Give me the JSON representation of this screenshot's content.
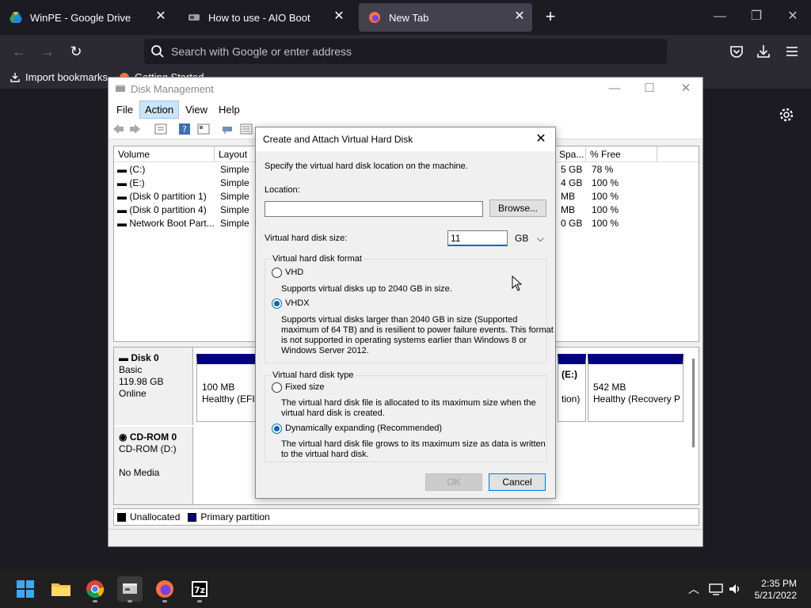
{
  "browser": {
    "tabs": [
      {
        "label": "WinPE - Google Drive",
        "active": false
      },
      {
        "label": "How to use - AIO Boot",
        "active": false
      },
      {
        "label": "New Tab",
        "active": true
      }
    ],
    "new_tab_glyph": "+",
    "controls": {
      "minimize": "—",
      "restore": "❐",
      "close": "✕"
    },
    "url_placeholder": "Search with Google or enter address",
    "bookmarks": {
      "import": "Import bookmarks...",
      "getting_started": "Getting Started"
    }
  },
  "disk_management": {
    "title": "Disk Management",
    "menu": [
      "File",
      "Action",
      "View",
      "Help"
    ],
    "selected_menu": "Action",
    "columns": {
      "volume": "Volume",
      "layout": "Layout",
      "free_space": "Spa...",
      "pct_free": "% Free"
    },
    "volumes": [
      {
        "name": "(C:)",
        "layout": "Simple",
        "free": "5 GB",
        "pct": "78 %"
      },
      {
        "name": "(E:)",
        "layout": "Simple",
        "free": "4 GB",
        "pct": "100 %"
      },
      {
        "name": "(Disk 0 partition 1)",
        "layout": "Simple",
        "free": "MB",
        "pct": "100 %"
      },
      {
        "name": "(Disk 0 partition 4)",
        "layout": "Simple",
        "free": "MB",
        "pct": "100 %"
      },
      {
        "name": "Network Boot Part...",
        "layout": "Simple",
        "free": "0 GB",
        "pct": "100 %"
      }
    ],
    "disk0": {
      "name": "Disk 0",
      "type": "Basic",
      "size": "119.98 GB",
      "status": "Online"
    },
    "disk0_partitions": {
      "p1_size": "100 MB",
      "p1_status": "Healthy (EFI S",
      "e_label": "(E:)",
      "e_status": "tion)",
      "recovery_size": "542 MB",
      "recovery_status": "Healthy (Recovery P"
    },
    "cdrom": {
      "name": "CD-ROM 0",
      "drive": "CD-ROM (D:)",
      "media": "No Media"
    },
    "legend": {
      "unallocated": "Unallocated",
      "primary": "Primary partition"
    }
  },
  "dialog": {
    "title": "Create and Attach Virtual Hard Disk",
    "instruction": "Specify the virtual hard disk location on the machine.",
    "location_label": "Location:",
    "location_value": "",
    "browse_label": "Browse...",
    "size_label": "Virtual hard disk size:",
    "size_value": "11",
    "size_unit": "GB",
    "format_group": "Virtual hard disk format",
    "vhd_label": "VHD",
    "vhd_desc": "Supports virtual disks up to 2040 GB in size.",
    "vhdx_label": "VHDX",
    "vhdx_desc_1": "Supports virtual disks larger than 2040 GB in size (Supported",
    "vhdx_desc_2": "maximum of 64 TB) and is resilient to power failure events. This format",
    "vhdx_desc_3": "is not supported in operating systems earlier than Windows 8 or",
    "vhdx_desc_4": "Windows Server 2012.",
    "type_group": "Virtual hard disk type",
    "fixed_label": "Fixed size",
    "fixed_desc_1": "The virtual hard disk file is allocated to its maximum size when the",
    "fixed_desc_2": "virtual hard disk is created.",
    "dynamic_label": "Dynamically expanding (Recommended)",
    "dynamic_desc_1": "The virtual hard disk file grows to its maximum size as data is written",
    "dynamic_desc_2": "to the virtual hard disk.",
    "ok_label": "OK",
    "cancel_label": "Cancel",
    "selected_format": "VHDX",
    "selected_type": "Dynamically expanding"
  },
  "taskbar": {
    "apps": [
      "start-icon",
      "file-explorer-icon",
      "chrome-icon",
      "disk-management-icon",
      "firefox-icon",
      "7zip-icon"
    ],
    "time": "2:35 PM",
    "date": "5/21/2022"
  },
  "colors": {
    "browser_bg": "#1c1b22",
    "browser_toolbar": "#2b2a33",
    "primary_partition": "#000080",
    "accent": "#0067c0"
  }
}
